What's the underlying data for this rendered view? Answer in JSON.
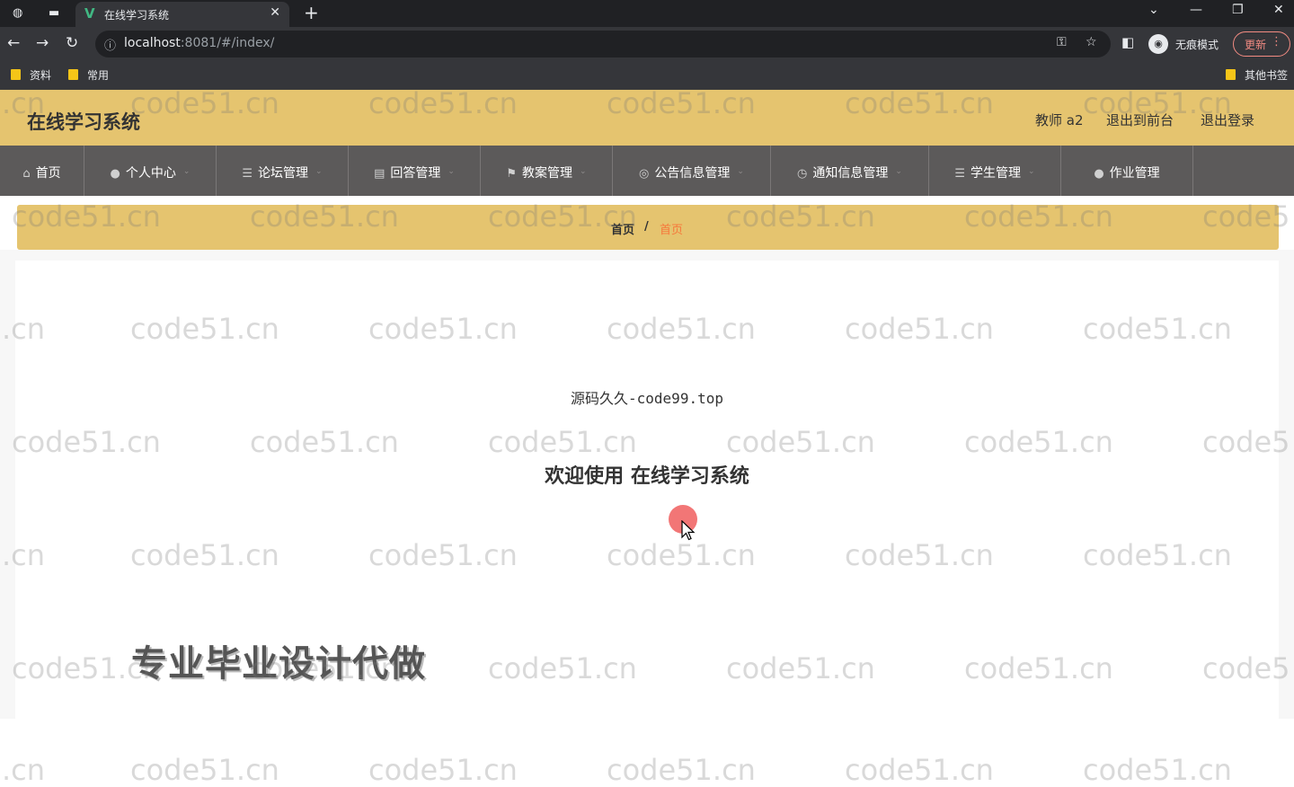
{
  "browser": {
    "tab_title": "在线学习系统",
    "url_host": "localhost",
    "url_rest": ":8081/#/index/",
    "incognito_label": "无痕模式",
    "update_label": "更新",
    "bookmarks": [
      "资料",
      "常用"
    ],
    "other_bookmarks": "其他书签"
  },
  "header": {
    "title": "在线学习系统",
    "user_label": "教师 a2",
    "front_label": "退出到前台",
    "logout_label": "退出登录",
    "accent_color": "#e5c46f"
  },
  "nav": {
    "items": [
      {
        "label": "首页",
        "icon": "home-icon"
      },
      {
        "label": "个人中心",
        "icon": "user-icon"
      },
      {
        "label": "论坛管理",
        "icon": "list-icon"
      },
      {
        "label": "回答管理",
        "icon": "clipboard-icon"
      },
      {
        "label": "教案管理",
        "icon": "flag-icon"
      },
      {
        "label": "公告信息管理",
        "icon": "compass-icon"
      },
      {
        "label": "通知信息管理",
        "icon": "clock-icon"
      },
      {
        "label": "学生管理",
        "icon": "list-icon"
      },
      {
        "label": "作业管理",
        "icon": "user-icon"
      }
    ]
  },
  "breadcrumb": {
    "home": "首页",
    "separator": "/",
    "current": "首页"
  },
  "main": {
    "source_text": "源码久久-code99.top",
    "welcome_text": "欢迎使用 在线学习系统",
    "promo_text": "专业毕业设计代做"
  },
  "watermark": {
    "text": "code51.cn",
    "partial_left": ".cn",
    "partial_right": "code5"
  }
}
